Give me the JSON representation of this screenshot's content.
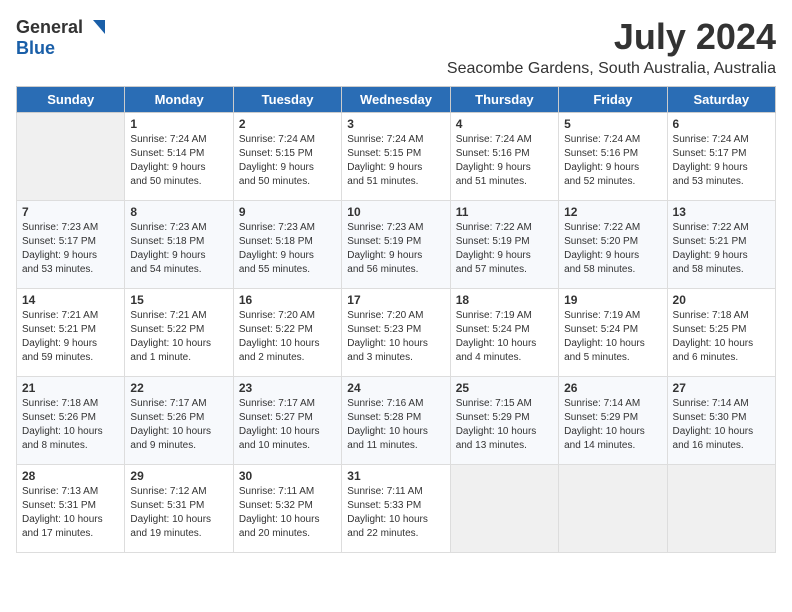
{
  "header": {
    "logo_general": "General",
    "logo_blue": "Blue",
    "month_year": "July 2024",
    "location": "Seacombe Gardens, South Australia, Australia"
  },
  "weekdays": [
    "Sunday",
    "Monday",
    "Tuesday",
    "Wednesday",
    "Thursday",
    "Friday",
    "Saturday"
  ],
  "weeks": [
    [
      {
        "day": "",
        "info": ""
      },
      {
        "day": "1",
        "info": "Sunrise: 7:24 AM\nSunset: 5:14 PM\nDaylight: 9 hours\nand 50 minutes."
      },
      {
        "day": "2",
        "info": "Sunrise: 7:24 AM\nSunset: 5:15 PM\nDaylight: 9 hours\nand 50 minutes."
      },
      {
        "day": "3",
        "info": "Sunrise: 7:24 AM\nSunset: 5:15 PM\nDaylight: 9 hours\nand 51 minutes."
      },
      {
        "day": "4",
        "info": "Sunrise: 7:24 AM\nSunset: 5:16 PM\nDaylight: 9 hours\nand 51 minutes."
      },
      {
        "day": "5",
        "info": "Sunrise: 7:24 AM\nSunset: 5:16 PM\nDaylight: 9 hours\nand 52 minutes."
      },
      {
        "day": "6",
        "info": "Sunrise: 7:24 AM\nSunset: 5:17 PM\nDaylight: 9 hours\nand 53 minutes."
      }
    ],
    [
      {
        "day": "7",
        "info": "Sunrise: 7:23 AM\nSunset: 5:17 PM\nDaylight: 9 hours\nand 53 minutes."
      },
      {
        "day": "8",
        "info": "Sunrise: 7:23 AM\nSunset: 5:18 PM\nDaylight: 9 hours\nand 54 minutes."
      },
      {
        "day": "9",
        "info": "Sunrise: 7:23 AM\nSunset: 5:18 PM\nDaylight: 9 hours\nand 55 minutes."
      },
      {
        "day": "10",
        "info": "Sunrise: 7:23 AM\nSunset: 5:19 PM\nDaylight: 9 hours\nand 56 minutes."
      },
      {
        "day": "11",
        "info": "Sunrise: 7:22 AM\nSunset: 5:19 PM\nDaylight: 9 hours\nand 57 minutes."
      },
      {
        "day": "12",
        "info": "Sunrise: 7:22 AM\nSunset: 5:20 PM\nDaylight: 9 hours\nand 58 minutes."
      },
      {
        "day": "13",
        "info": "Sunrise: 7:22 AM\nSunset: 5:21 PM\nDaylight: 9 hours\nand 58 minutes."
      }
    ],
    [
      {
        "day": "14",
        "info": "Sunrise: 7:21 AM\nSunset: 5:21 PM\nDaylight: 9 hours\nand 59 minutes."
      },
      {
        "day": "15",
        "info": "Sunrise: 7:21 AM\nSunset: 5:22 PM\nDaylight: 10 hours\nand 1 minute."
      },
      {
        "day": "16",
        "info": "Sunrise: 7:20 AM\nSunset: 5:22 PM\nDaylight: 10 hours\nand 2 minutes."
      },
      {
        "day": "17",
        "info": "Sunrise: 7:20 AM\nSunset: 5:23 PM\nDaylight: 10 hours\nand 3 minutes."
      },
      {
        "day": "18",
        "info": "Sunrise: 7:19 AM\nSunset: 5:24 PM\nDaylight: 10 hours\nand 4 minutes."
      },
      {
        "day": "19",
        "info": "Sunrise: 7:19 AM\nSunset: 5:24 PM\nDaylight: 10 hours\nand 5 minutes."
      },
      {
        "day": "20",
        "info": "Sunrise: 7:18 AM\nSunset: 5:25 PM\nDaylight: 10 hours\nand 6 minutes."
      }
    ],
    [
      {
        "day": "21",
        "info": "Sunrise: 7:18 AM\nSunset: 5:26 PM\nDaylight: 10 hours\nand 8 minutes."
      },
      {
        "day": "22",
        "info": "Sunrise: 7:17 AM\nSunset: 5:26 PM\nDaylight: 10 hours\nand 9 minutes."
      },
      {
        "day": "23",
        "info": "Sunrise: 7:17 AM\nSunset: 5:27 PM\nDaylight: 10 hours\nand 10 minutes."
      },
      {
        "day": "24",
        "info": "Sunrise: 7:16 AM\nSunset: 5:28 PM\nDaylight: 10 hours\nand 11 minutes."
      },
      {
        "day": "25",
        "info": "Sunrise: 7:15 AM\nSunset: 5:29 PM\nDaylight: 10 hours\nand 13 minutes."
      },
      {
        "day": "26",
        "info": "Sunrise: 7:14 AM\nSunset: 5:29 PM\nDaylight: 10 hours\nand 14 minutes."
      },
      {
        "day": "27",
        "info": "Sunrise: 7:14 AM\nSunset: 5:30 PM\nDaylight: 10 hours\nand 16 minutes."
      }
    ],
    [
      {
        "day": "28",
        "info": "Sunrise: 7:13 AM\nSunset: 5:31 PM\nDaylight: 10 hours\nand 17 minutes."
      },
      {
        "day": "29",
        "info": "Sunrise: 7:12 AM\nSunset: 5:31 PM\nDaylight: 10 hours\nand 19 minutes."
      },
      {
        "day": "30",
        "info": "Sunrise: 7:11 AM\nSunset: 5:32 PM\nDaylight: 10 hours\nand 20 minutes."
      },
      {
        "day": "31",
        "info": "Sunrise: 7:11 AM\nSunset: 5:33 PM\nDaylight: 10 hours\nand 22 minutes."
      },
      {
        "day": "",
        "info": ""
      },
      {
        "day": "",
        "info": ""
      },
      {
        "day": "",
        "info": ""
      }
    ]
  ]
}
